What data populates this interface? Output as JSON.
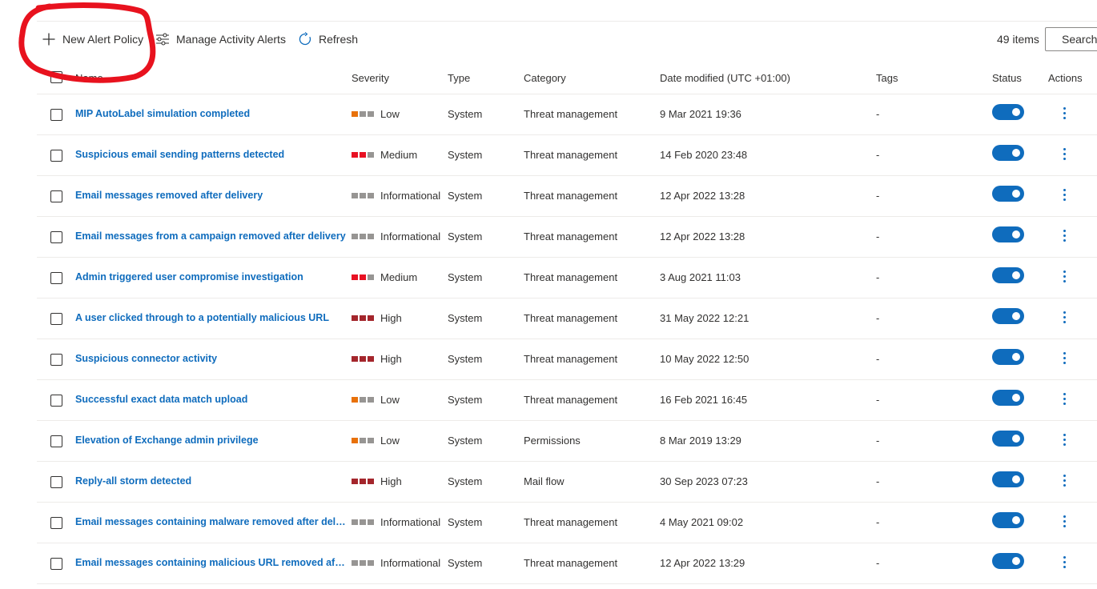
{
  "toolbar": {
    "new_policy_label": "New Alert Policy",
    "new_policy_icon": "plus-icon",
    "manage_label": "Manage Activity Alerts",
    "manage_icon": "sliders-icon",
    "refresh_label": "Refresh",
    "refresh_icon": "refresh-icon",
    "items_count": "49 items",
    "search_placeholder": "Search",
    "search_icon": "search-icon"
  },
  "columns": {
    "name": "Name",
    "severity": "Severity",
    "type": "Type",
    "category": "Category",
    "date": "Date modified (UTC +01:00)",
    "tags": "Tags",
    "status": "Status",
    "actions": "Actions"
  },
  "colors": {
    "accent": "#0f6cbd",
    "low": "#e8710a",
    "medium": "#e81123",
    "high": "#a4262c",
    "inactive": "#979593",
    "annotation": "#e8121e"
  },
  "rows": [
    {
      "name": "MIP AutoLabel simulation completed",
      "severity": "Low",
      "level": 1,
      "type": "System",
      "category": "Threat management",
      "date": "9 Mar 2021 19:36",
      "tags": "-",
      "status": "On"
    },
    {
      "name": "Suspicious email sending patterns detected",
      "severity": "Medium",
      "level": 2,
      "type": "System",
      "category": "Threat management",
      "date": "14 Feb 2020 23:48",
      "tags": "-",
      "status": "On"
    },
    {
      "name": "Email messages removed after delivery",
      "severity": "Informational",
      "level": 0,
      "type": "System",
      "category": "Threat management",
      "date": "12 Apr 2022 13:28",
      "tags": "-",
      "status": "On"
    },
    {
      "name": "Email messages from a campaign removed after delivery",
      "severity": "Informational",
      "level": 0,
      "type": "System",
      "category": "Threat management",
      "date": "12 Apr 2022 13:28",
      "tags": "-",
      "status": "On"
    },
    {
      "name": "Admin triggered user compromise investigation",
      "severity": "Medium",
      "level": 2,
      "type": "System",
      "category": "Threat management",
      "date": "3 Aug 2021 11:03",
      "tags": "-",
      "status": "On"
    },
    {
      "name": "A user clicked through to a potentially malicious URL",
      "severity": "High",
      "level": 3,
      "type": "System",
      "category": "Threat management",
      "date": "31 May 2022 12:21",
      "tags": "-",
      "status": "On"
    },
    {
      "name": "Suspicious connector activity",
      "severity": "High",
      "level": 3,
      "type": "System",
      "category": "Threat management",
      "date": "10 May 2022 12:50",
      "tags": "-",
      "status": "On"
    },
    {
      "name": "Successful exact data match upload",
      "severity": "Low",
      "level": 1,
      "type": "System",
      "category": "Threat management",
      "date": "16 Feb 2021 16:45",
      "tags": "-",
      "status": "On"
    },
    {
      "name": "Elevation of Exchange admin privilege",
      "severity": "Low",
      "level": 1,
      "type": "System",
      "category": "Permissions",
      "date": "8 Mar 2019 13:29",
      "tags": "-",
      "status": "On"
    },
    {
      "name": "Reply-all storm detected",
      "severity": "High",
      "level": 3,
      "type": "System",
      "category": "Mail flow",
      "date": "30 Sep 2023 07:23",
      "tags": "-",
      "status": "On"
    },
    {
      "name": "Email messages containing malware removed after delivery",
      "severity": "Informational",
      "level": 0,
      "type": "System",
      "category": "Threat management",
      "date": "4 May 2021 09:02",
      "tags": "-",
      "status": "On"
    },
    {
      "name": "Email messages containing malicious URL removed after delivery",
      "severity": "Informational",
      "level": 0,
      "type": "System",
      "category": "Threat management",
      "date": "12 Apr 2022 13:29",
      "tags": "-",
      "status": "On"
    }
  ]
}
